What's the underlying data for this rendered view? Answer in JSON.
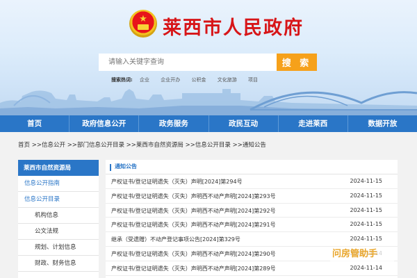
{
  "header": {
    "title": "莱西市人民政府",
    "emblem_star": "★"
  },
  "search": {
    "placeholder": "请输入关键字查询",
    "button_label": "搜 索",
    "hot_label": "搜索热词:",
    "hot_words": [
      "企业",
      "企业开办",
      "公积金",
      "文化旅游",
      "项目"
    ]
  },
  "nav": {
    "items": [
      "首页",
      "政府信息公开",
      "政务服务",
      "政民互动",
      "走进莱西",
      "数据开放"
    ]
  },
  "breadcrumb": {
    "items": [
      "首页",
      "信息公开",
      "部门信息公开目录",
      "莱西市自然资源局",
      "信息公开目录",
      "通知公告"
    ],
    "separator": ">>"
  },
  "sidebar": {
    "heading": "莱西市自然资源局",
    "items": [
      {
        "label": "信息公开指南",
        "level": "top"
      },
      {
        "label": "信息公开目录",
        "level": "top"
      },
      {
        "label": "机构信息",
        "level": "sub"
      },
      {
        "label": "公文法规",
        "level": "sub"
      },
      {
        "label": "规划、计划信息",
        "level": "sub"
      },
      {
        "label": "财政、财务信息",
        "level": "sub"
      }
    ]
  },
  "main": {
    "section_title": "通知公告",
    "rows": [
      {
        "title": "产权证书/登记证明遗失（灭失）声明[2024]第294号",
        "date": "2024-11-15"
      },
      {
        "title": "产权证书/登记证明遗失（灭失）声明西不动产声明[2024]第293号",
        "date": "2024-11-15"
      },
      {
        "title": "产权证书/登记证明遗失（灭失）声明西不动产声明[2024]第292号",
        "date": "2024-11-15"
      },
      {
        "title": "产权证书/登记证明遗失（灭失）声明西不动产声明[2024]第291号",
        "date": "2024-11-15"
      },
      {
        "title": "继承（受遗赠）不动产登记事项公告[2024]第329号",
        "date": "2024-11-15"
      },
      {
        "title": "产权证书/登记证明遗失（灭失）声明西不动产声明[2024]第290号",
        "date": "2024-11-14"
      },
      {
        "title": "产权证书/登记证明遗失（灭失）声明西不动产声明[2024]第289号",
        "date": "2024-11-14"
      }
    ]
  },
  "watermark": {
    "text": "问房管助手"
  },
  "colors": {
    "brand_red": "#d71518",
    "nav_blue": "#2a76c7",
    "search_orange": "#f6a11a"
  }
}
